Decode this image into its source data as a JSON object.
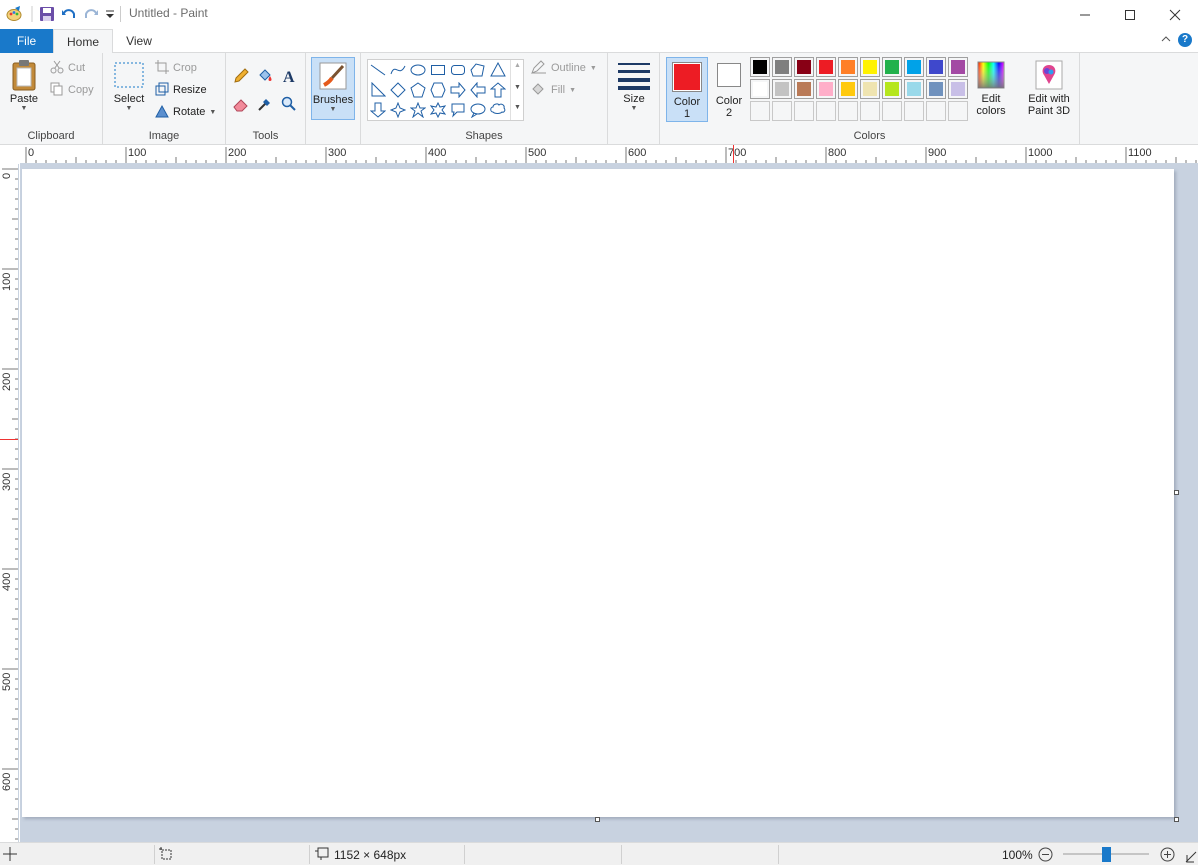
{
  "window": {
    "title": "Untitled - Paint"
  },
  "tabs": [
    {
      "label": "File"
    },
    {
      "label": "Home"
    },
    {
      "label": "View"
    }
  ],
  "clipboard": {
    "group_label": "Clipboard",
    "paste_label": "Paste",
    "cut_label": "Cut",
    "copy_label": "Copy"
  },
  "image": {
    "group_label": "Image",
    "select_label": "Select",
    "crop_label": "Crop",
    "resize_label": "Resize",
    "rotate_label": "Rotate"
  },
  "tools": {
    "group_label": "Tools"
  },
  "brushes": {
    "label": "Brushes"
  },
  "shapes": {
    "group_label": "Shapes",
    "outline_label": "Outline",
    "fill_label": "Fill"
  },
  "size": {
    "label": "Size"
  },
  "colors": {
    "group_label": "Colors",
    "color1_label_line1": "Color",
    "color1_label_line2": "1",
    "color2_label_line1": "Color",
    "color2_label_line2": "2",
    "color1_value": "#ed1c24",
    "color2_value": "#ffffff",
    "edit_colors_line1": "Edit",
    "edit_colors_line2": "colors",
    "paint3d_line1": "Edit with",
    "paint3d_line2": "Paint 3D",
    "palette_row1": [
      "#000000",
      "#7f7f7f",
      "#880015",
      "#ed1c24",
      "#ff7f27",
      "#fff200",
      "#22b14c",
      "#00a2e8",
      "#3f48cc",
      "#a349a4"
    ],
    "palette_row2": [
      "#ffffff",
      "#c3c3c3",
      "#b97a57",
      "#ffaec9",
      "#ffc90e",
      "#efe4b0",
      "#b5e61d",
      "#99d9ea",
      "#7092be",
      "#c8bfe7"
    ],
    "palette_row3": [
      "",
      "",
      "",
      "",
      "",
      "",
      "",
      "",
      "",
      ""
    ]
  },
  "ruler": {
    "h_labels": [
      "0",
      "100",
      "200",
      "300",
      "400",
      "500",
      "600",
      "700",
      "800",
      "900",
      "1000",
      "1100"
    ],
    "v_labels": [
      "0",
      "100",
      "200",
      "300",
      "400",
      "500",
      "600"
    ]
  },
  "status": {
    "canvas_size": "1152 × 648px",
    "zoom": "100%"
  }
}
